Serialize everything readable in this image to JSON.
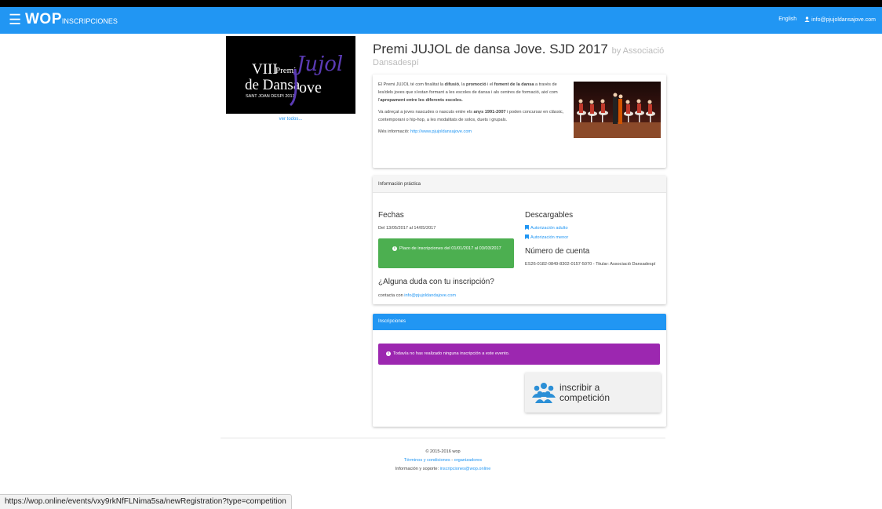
{
  "navbar": {
    "menu_icon": "menu-icon",
    "brand": "WOP",
    "brand_sub": "INSCRIPCIONES",
    "language": "English",
    "user_email": "info@pjujoldansajove.com",
    "color": "#2196f3"
  },
  "poster": {
    "line1": "VIII",
    "line1b": "Premi",
    "line2": "de Dansa",
    "line3": "SANT JOAN DESPI 2017",
    "jujol": "Jujol",
    "jove": "ove",
    "ver_todos": "ver todos..."
  },
  "event": {
    "title": "Premi JUJOL de dansa Jove. SJD 2017",
    "by": "by Associació",
    "org": "Dansadespí"
  },
  "description": {
    "p1_a": "El Premi JUJOL té com finalitat la ",
    "p1_b": "difusió",
    "p1_c": ", la ",
    "p1_d": "promoció",
    "p1_e": " i el ",
    "p1_f": "foment de la dansa",
    "p1_g": " a través de les/dels joves que s'estan formant a les escoles de dansa i als centres de formació, així com l'",
    "p1_h": "apropament entre les diferents escoles.",
    "p2_a": "Va adreçat a joves nascudes o nascuts entre els ",
    "p2_b": "anys 1991-2007",
    "p2_c": " i poden concursar en clàssic, contemporani o hip-hop, a les modalitats de solos, duets i grupals.",
    "p3_label": "Més informació: ",
    "p3_link": "http://www.pjujoldansajove.com"
  },
  "info": {
    "header": "Información práctica",
    "fechas_title": "Fechas",
    "fechas_value": "Del 13/05/2017 al 14/05/2017",
    "plazo": "Plazo de inscripciones del 01/01/2017 al 03/03/2017",
    "duda_title": "¿Alguna duda con tu inscripción?",
    "contacta_label": "contacta con ",
    "contacta_email": "info@pjujoldandajove.com",
    "descargables_title": "Descargables",
    "autorizacion_adulto": "Autorización adulto",
    "autorizacion_menor": "Autorización menor",
    "cuenta_title": "Número de cuenta",
    "cuenta_value": "ES26-0182-0849-8302-0157-5070 - Titular: Associació Dansadespí"
  },
  "inscripciones": {
    "header": "Inscripciones",
    "alert": "Todavía no has realizado ninguna inscripción a este evento.",
    "button_line1": "inscribir a",
    "button_line2": "competición",
    "button_icon": "group-icon"
  },
  "footer": {
    "copyright": "© 2015-2016 wop",
    "terms": "Términos y condiciones",
    "sep": " - ",
    "organizers": "organizadores",
    "support_label": "Información y soporte: ",
    "support_email": "inscripciones@wop.online"
  },
  "status_bar": {
    "url": "https://wop.online/events/vxy9rkNfFLNima5sa/newRegistration?type=competition"
  },
  "colors": {
    "primary": "#2196f3",
    "success": "#4caf50",
    "purple": "#9c27b0"
  }
}
